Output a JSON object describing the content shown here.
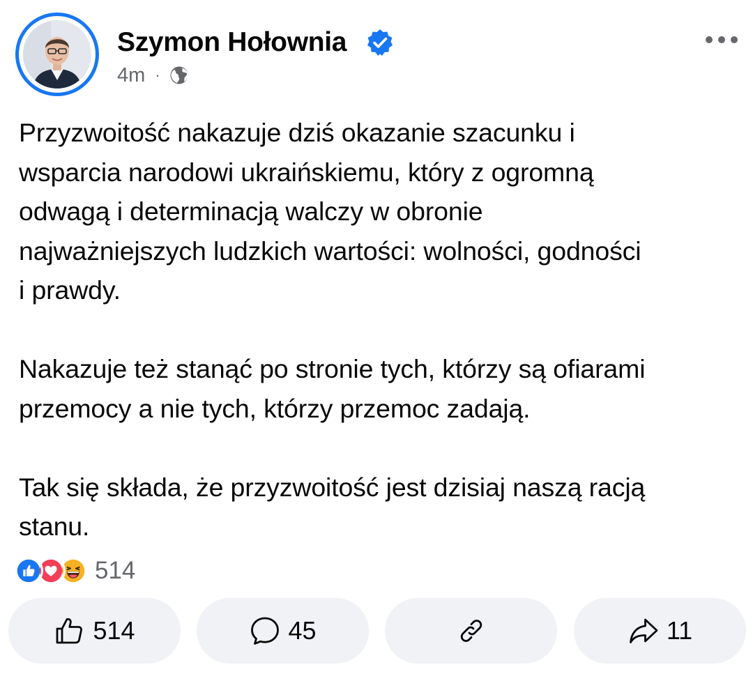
{
  "post": {
    "author": {
      "name": "Szymon Hołownia",
      "verified_icon": "verified-badge-icon",
      "avatar_icon": "profile-photo"
    },
    "meta": {
      "time": "4m",
      "separator": "·",
      "audience_icon": "globe-icon"
    },
    "more_icon": "more-options-icon",
    "paragraphs": [
      "Przyzwoitość nakazuje dziś okazanie szacunku i\nwsparcia narodowi ukraińskiemu, który z ogromną\nodwagą i determinacją walczy w obronie\nnajważniejszych ludzkich wartości: wolności, godności\ni prawdy.",
      "Nakazuje też stanąć po stronie tych, którzy są ofiarami\nprzemocy a nie tych, którzy przemoc zadają.",
      "Tak się składa, że przyzwoitość jest dzisiaj naszą racją\nstanu."
    ],
    "reactions": {
      "icons": [
        "like-reaction-icon",
        "love-reaction-icon",
        "haha-reaction-icon"
      ],
      "count": "514"
    },
    "actions": {
      "like": {
        "icon": "thumbs-up-icon",
        "count": "514"
      },
      "comment": {
        "icon": "comment-bubble-icon",
        "count": "45"
      },
      "link": {
        "icon": "link-icon"
      },
      "share": {
        "icon": "share-arrow-icon",
        "count": "11"
      }
    },
    "colors": {
      "accent": "#1877f2",
      "text": "#080809",
      "secondary_text": "#65676b",
      "button_bg": "#f0f2f5",
      "love": "#f33e58",
      "haha": "#f7b125"
    }
  }
}
